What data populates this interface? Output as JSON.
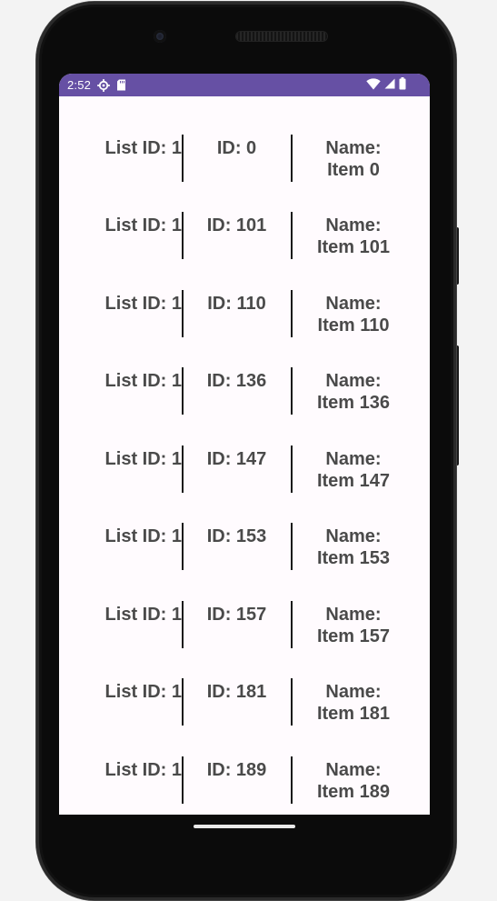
{
  "status_bar": {
    "time": "2:52",
    "icons_left": [
      "settings-gear-icon",
      "sd-card-icon"
    ],
    "icons_right": [
      "wifi-icon",
      "cell-signal-icon",
      "battery-icon"
    ],
    "color": "#6650a4"
  },
  "list": {
    "rows": [
      {
        "list_id": "List ID: 1",
        "id": "ID: 0",
        "name_label": "Name:",
        "name_value": "Item 0"
      },
      {
        "list_id": "List ID: 1",
        "id": "ID: 101",
        "name_label": "Name:",
        "name_value": "Item 101"
      },
      {
        "list_id": "List ID: 1",
        "id": "ID: 110",
        "name_label": "Name:",
        "name_value": "Item 110"
      },
      {
        "list_id": "List ID: 1",
        "id": "ID: 136",
        "name_label": "Name:",
        "name_value": "Item 136"
      },
      {
        "list_id": "List ID: 1",
        "id": "ID: 147",
        "name_label": "Name:",
        "name_value": "Item 147"
      },
      {
        "list_id": "List ID: 1",
        "id": "ID: 153",
        "name_label": "Name:",
        "name_value": "Item 153"
      },
      {
        "list_id": "List ID: 1",
        "id": "ID: 157",
        "name_label": "Name:",
        "name_value": "Item 157"
      },
      {
        "list_id": "List ID: 1",
        "id": "ID: 181",
        "name_label": "Name:",
        "name_value": "Item 181"
      },
      {
        "list_id": "List ID: 1",
        "id": "ID: 189",
        "name_label": "Name:",
        "name_value": "Item 189"
      }
    ]
  },
  "colors": {
    "screen_background": "#fffbfe",
    "text": "#4a4a4a",
    "divider": "#1a1a1a"
  }
}
